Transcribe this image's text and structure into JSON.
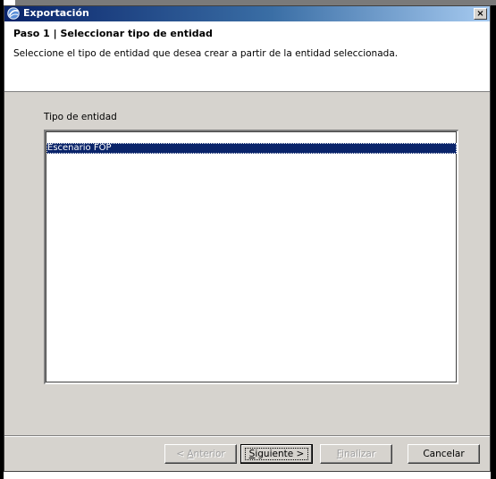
{
  "window": {
    "title": "Exportación",
    "close_glyph": "×"
  },
  "header": {
    "step_title": "Paso 1 | Seleccionar tipo de entidad",
    "step_description": "Seleccione el tipo de entidad que desea crear a partir de la entidad seleccionada."
  },
  "entity_list": {
    "label": "Tipo de entidad",
    "items": [
      {
        "label": "Escenario FOP",
        "selected": true
      }
    ]
  },
  "buttons": {
    "prev": {
      "mnemonic": "A",
      "rest": "nterior",
      "prefix": "< ",
      "enabled": false
    },
    "next": {
      "mnemonic": "S",
      "rest": "iguiente >",
      "enabled": true
    },
    "finish": {
      "mnemonic": "F",
      "rest": "inalizar",
      "enabled": false
    },
    "cancel": {
      "label": "Cancelar",
      "enabled": true
    }
  },
  "colors": {
    "titlebar_start": "#0a246a",
    "selection": "#0a246a",
    "dialog_bg": "#d6d3ce"
  }
}
